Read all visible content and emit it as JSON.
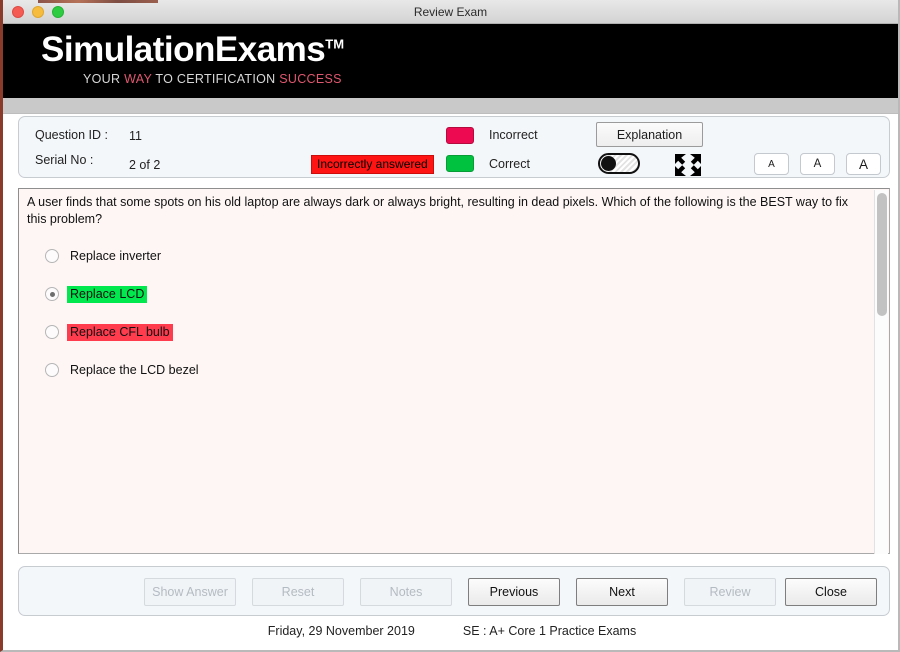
{
  "window": {
    "title": "Review Exam",
    "traffic_lights": [
      "close-red",
      "minimize-yellow",
      "zoom-green"
    ]
  },
  "banner": {
    "brand_name": "SimulationExams",
    "trademark": "TM",
    "tagline_parts": [
      {
        "text": "YOUR ",
        "color": "#d8d8d8"
      },
      {
        "text": "WAY ",
        "color": "#e0576f"
      },
      {
        "text": "TO CERTIFICATION ",
        "color": "#d8d8d8"
      },
      {
        "text": "SUCCESS",
        "color": "#e0576f"
      }
    ],
    "tagline_white_1": "YOUR ",
    "tagline_pink_1": "WAY",
    "tagline_white_2": " TO CERTIFICATION ",
    "tagline_pink_2": "SUCCESS",
    "background_color": "#000000"
  },
  "info": {
    "question_id_label": "Question ID :",
    "question_id_value": "11",
    "serial_no_label": "Serial No :",
    "serial_no_value": "2 of 2",
    "answered_status": "Incorrectly answered",
    "answered_status_bg": "#ff1414",
    "legend": [
      {
        "label": "Incorrect",
        "color": "#ee0a50"
      },
      {
        "label": "Correct",
        "color": "#00c23f"
      }
    ],
    "explanation_label": "Explanation",
    "toggle_state": "off",
    "expand_icon": "fullscreen-icon",
    "font_size_buttons": [
      "A",
      "A",
      "A"
    ]
  },
  "question": {
    "text": "A user finds that some spots on his old laptop are always dark or always bright, resulting in dead pixels. Which of the following is the BEST way to fix this problem?",
    "options": [
      {
        "label": "Replace inverter",
        "selected": false,
        "highlight": "none"
      },
      {
        "label": "Replace LCD",
        "selected": true,
        "highlight": "correct"
      },
      {
        "label": "Replace CFL bulb",
        "selected": false,
        "highlight": "incorrect"
      },
      {
        "label": "Replace the LCD bezel",
        "selected": false,
        "highlight": "none"
      }
    ],
    "panel_background": "#fdf6f4",
    "scroll_position_percent": 0
  },
  "buttons": [
    {
      "label": "Show Answer",
      "enabled": false
    },
    {
      "label": "Reset",
      "enabled": false
    },
    {
      "label": "Notes",
      "enabled": false
    },
    {
      "label": "Previous",
      "enabled": true
    },
    {
      "label": "Next",
      "enabled": true
    },
    {
      "label": "Review",
      "enabled": false
    },
    {
      "label": "Close",
      "enabled": true
    }
  ],
  "footer": {
    "date": "Friday, 29 November 2019",
    "exam_name": "SE : A+ Core 1 Practice Exams"
  }
}
